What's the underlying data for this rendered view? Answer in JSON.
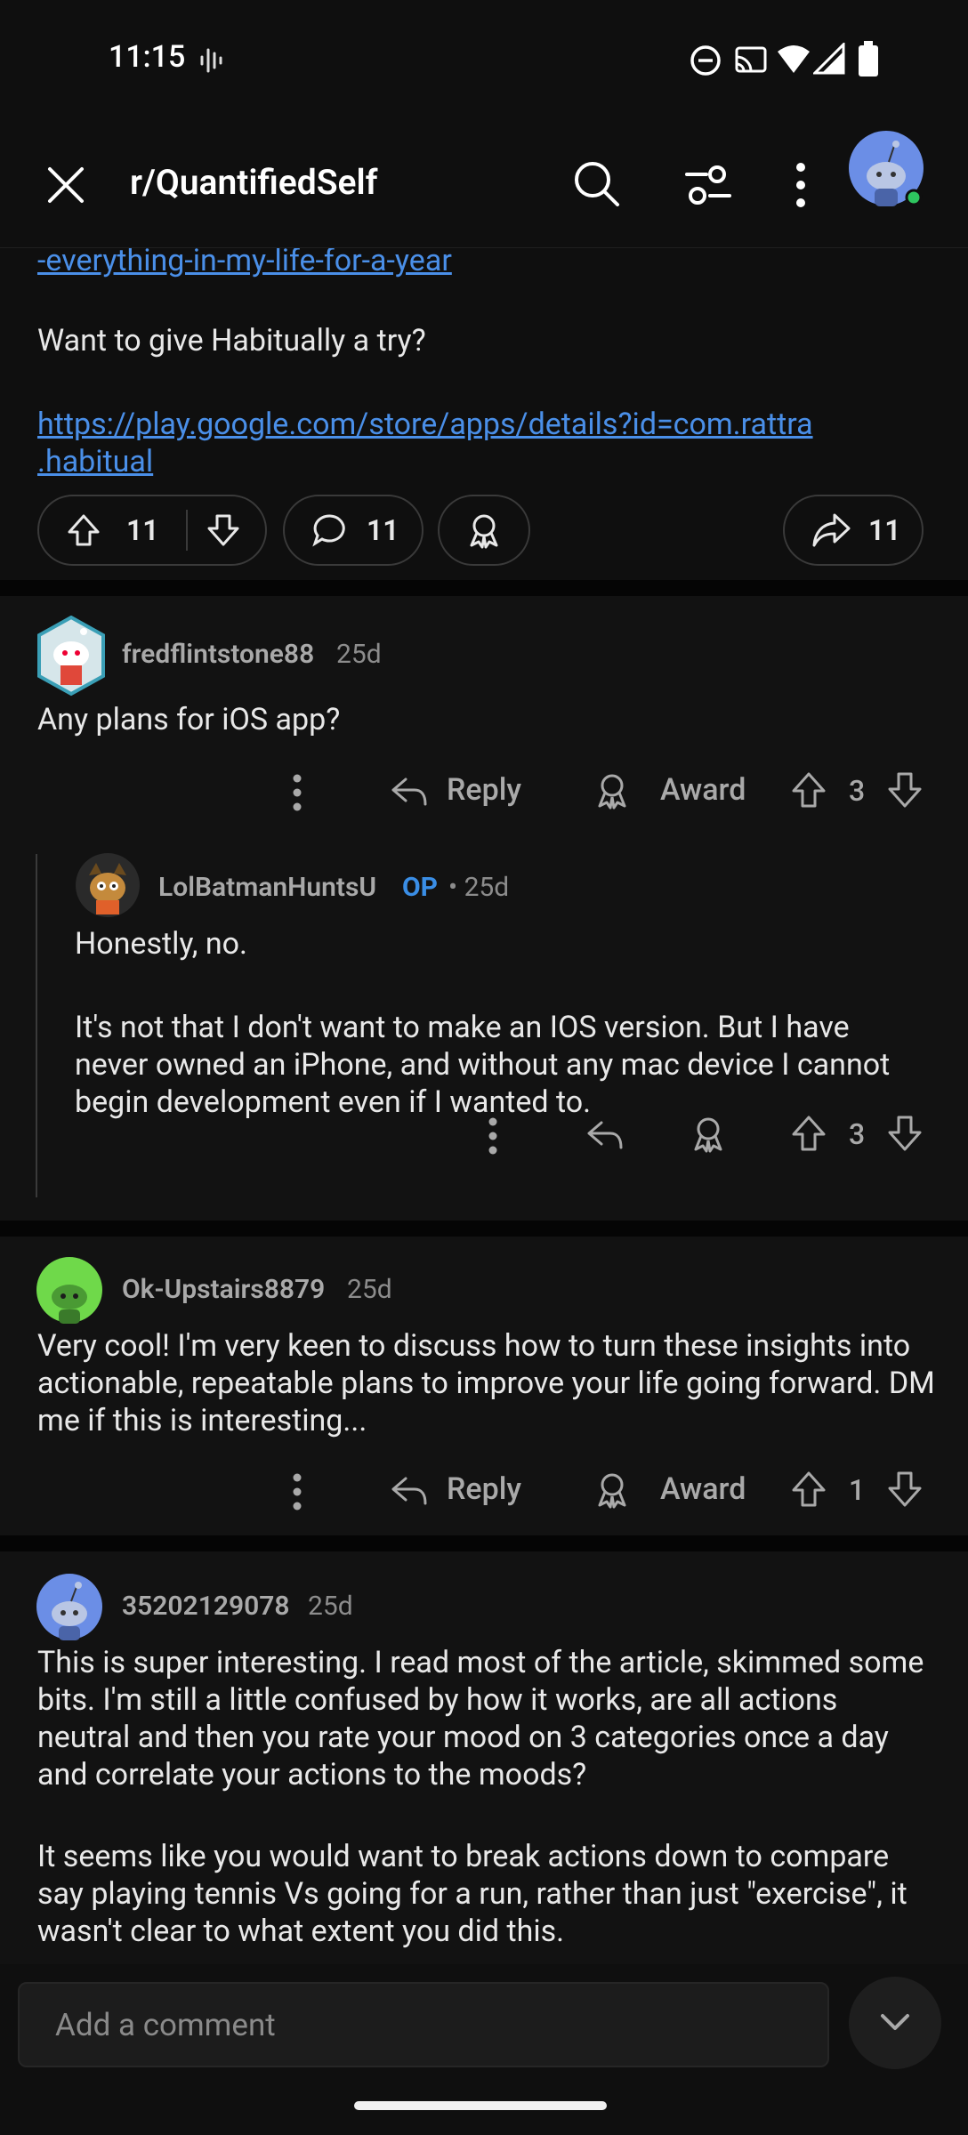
{
  "status_bar": {
    "time": "11:15"
  },
  "header": {
    "title": "r/QuantifiedSelf"
  },
  "post": {
    "link_tail": "-everything-in-my-life-for-a-year",
    "cta_text": "Want to give Habitually a try?",
    "store_link_line1": "https://play.google.com/store/apps/details?id=com.rattra",
    "store_link_line2": ".habitual",
    "upvotes": "11",
    "comments": "11",
    "shares": "11"
  },
  "comments": [
    {
      "author": "fredflintstone88",
      "age": "25d",
      "body": "Any plans for iOS app?",
      "reply_label": "Reply",
      "award_label": "Award",
      "votes": "3"
    },
    {
      "author": "LolBatmanHuntsU",
      "op_badge": "OP",
      "age": "• 25d",
      "body_line1": "Honestly, no.",
      "body_para2": "It's not that I don't want to make an IOS version. But I have never owned an iPhone, and without any mac device I cannot begin development even if I wanted to.",
      "votes": "3"
    },
    {
      "author": "Ok-Upstairs8879",
      "age": "25d",
      "body": "Very cool! I'm very keen to discuss how to turn these insights into actionable, repeatable plans to improve your life going forward. DM me if this is interesting...",
      "reply_label": "Reply",
      "award_label": "Award",
      "votes": "1"
    },
    {
      "author": "35202129078",
      "age": "25d",
      "body_para1": "This is super interesting. I read most of the article, skimmed some bits. I'm still a little confused by how it works, are all actions neutral and then you rate your mood on 3 categories once a day and correlate your actions to the moods?",
      "body_para2": "It seems like you would want to break actions down to compare say playing tennis Vs going for a run, rather than just \"exercise\", it wasn't clear to what extent you did this."
    }
  ],
  "bottom": {
    "comment_placeholder": "Add a comment"
  },
  "colors": {
    "link": "#4a8fe8",
    "op_badge": "#3a8ee6",
    "online": "#2ec55f"
  }
}
